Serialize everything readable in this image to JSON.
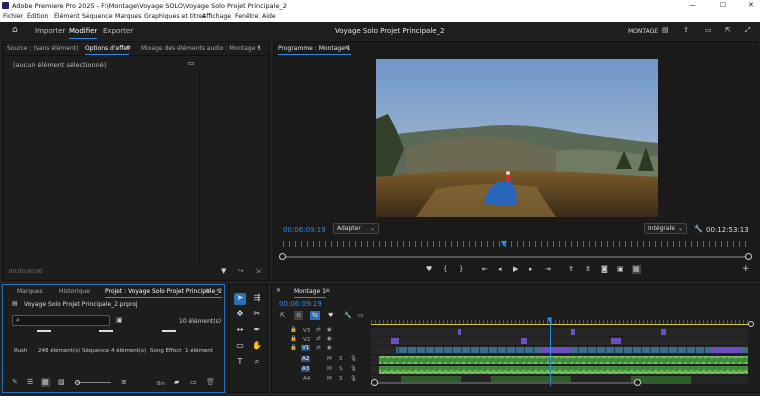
{
  "window": {
    "title": "Adobe Premiere Pro 2025 - F:\\Montage\\Voyage SOLO\\Voyage Solo Projet Principale_2",
    "minimize": "—",
    "maximize": "☐",
    "close": "✕"
  },
  "menu": [
    "Fichier",
    "Édition",
    "Élément",
    "Séquence",
    "Marques",
    "Graphiques et titres",
    "Affichage",
    "Fenêtre",
    "Aide"
  ],
  "workspace": {
    "home_icon": "home-icon",
    "tabs": [
      "Importer",
      "Modifier",
      "Exporter"
    ],
    "active": "Modifier",
    "project_title": "Voyage Solo Projet Principale_2",
    "mode": "MONTAGE"
  },
  "source_panel": {
    "tabs": [
      "Source : (sans élément)",
      "Options d'effet",
      "Mixage des éléments audio : Montage 1"
    ],
    "active": "Options d'effet",
    "empty_label": "(aucun élément sélectionné)",
    "timecode": "00;00;00;00"
  },
  "program_panel": {
    "title": "Programme : Montage 1",
    "timecode": "00:06:09:19",
    "fit": "Adapter",
    "quality": "Intégrale",
    "duration": "00:12:53:13"
  },
  "project_panel": {
    "tabs": [
      "Marques",
      "Historique",
      "Projet : Voyage Solo Projet Principale_2"
    ],
    "active": "Projet : Voyage Solo Projet Principale_2",
    "file": "Voyage Solo Projet Principale_2.prproj",
    "count": "10 élément(s)",
    "bins": [
      {
        "name": "Rush",
        "count": "248 élément(s)"
      },
      {
        "name": "Séquence",
        "count": "4 élément(s)"
      },
      {
        "name": "Song Effect",
        "count": "1 élément"
      }
    ],
    "bin_label": "Bin"
  },
  "timeline": {
    "tab": "Montage 1",
    "timecode": "00:06:09:19",
    "tracks": [
      {
        "name": "V3",
        "type": "video"
      },
      {
        "name": "V2",
        "type": "video"
      },
      {
        "name": "V1",
        "type": "video",
        "target": true
      },
      {
        "name": "A2",
        "type": "audio",
        "target": true
      },
      {
        "name": "A3",
        "type": "audio",
        "target": true
      },
      {
        "name": "A4",
        "type": "audio"
      }
    ],
    "mute": "M",
    "solo": "S"
  },
  "colors": {
    "accent": "#2d8ceb",
    "video_clip": "#3a6d8c",
    "video_clip_alt": "#6d4fc4",
    "audio_clip": "#3e8a3a",
    "audio_wave": "#8fd36d",
    "playhead": "#2d8ceb",
    "yellow": "#d4c64b"
  }
}
